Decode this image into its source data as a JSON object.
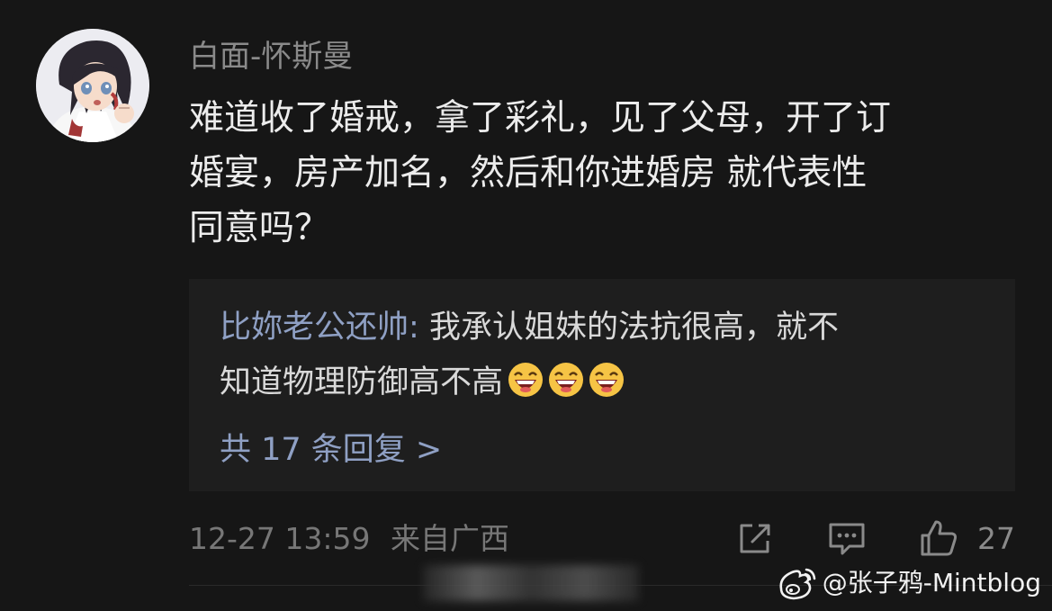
{
  "comment": {
    "username": "白面-怀斯曼",
    "text_lines": [
      "难道收了婚戒，拿了彩礼，见了父母，开了订",
      "婚宴，房产加名，然后和你进婚房 就代表性",
      "同意吗？"
    ]
  },
  "reply": {
    "author": "比妳老公还帅",
    "separator": ": ",
    "text_line1": "我承认姐妹的法抗很高，就不",
    "text_line2": "知道物理防御高不高",
    "emojis": [
      "laughing-emoji",
      "laughing-emoji",
      "laughing-emoji"
    ],
    "more_replies_label": "共 17 条回复 >"
  },
  "meta": {
    "timestamp": "12-27 13:59",
    "location": "来自广西"
  },
  "actions": {
    "share_icon": "share-icon",
    "comment_icon": "comment-icon",
    "like_icon": "thumbs-up-icon",
    "like_count": "27"
  },
  "watermark": {
    "icon": "weibo-logo-icon",
    "text": "@张子鸦-Mintblog"
  },
  "colors": {
    "background": "#161616",
    "reply_background": "#1e1e1e",
    "link_blue": "#8fa0c4"
  }
}
